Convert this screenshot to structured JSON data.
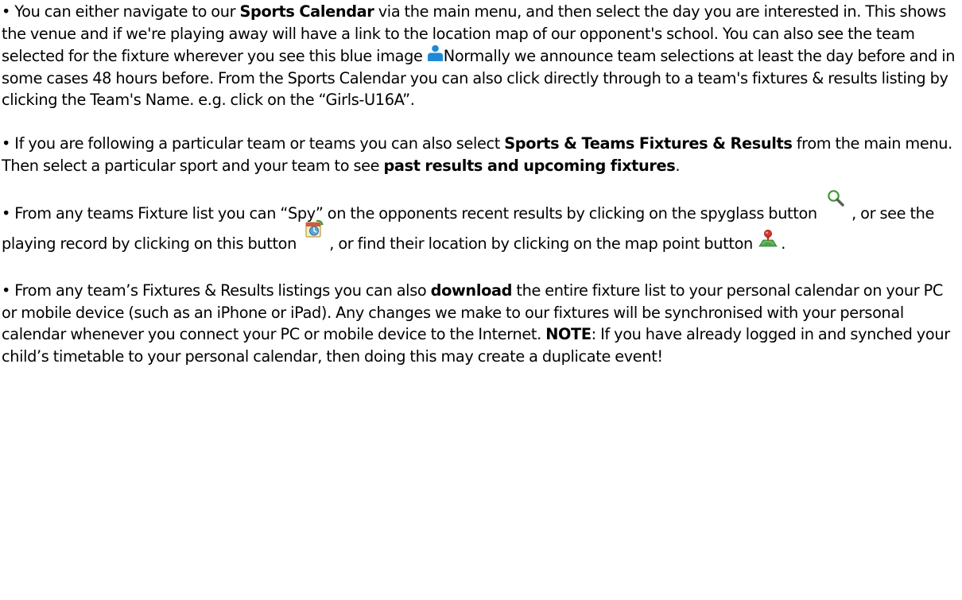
{
  "p1": {
    "t1": "• You can either navigate to our ",
    "b1": "Sports Calendar",
    "t2": " via the main menu, and then select the day you are interested in. This shows the venue and if we're playing away will have a link to the location map of our opponent's school. You can also see the team selected for the fixture wherever you see this blue image ",
    "t3": "Normally we announce team selections at least the day before and in some cases 48 hours before. From the Sports Calendar you can also click directly through to a team's fixtures & results listing by clicking the Team's Name. e.g. click on the “Girls-U16A”."
  },
  "p2": {
    "t1": "• If you are following a particular team or teams you can also select ",
    "b1": "Sports & Teams Fixtures & Results",
    "t2": " from the main menu. Then select a particular sport and your team to see ",
    "b2": "past results and upcoming fixtures",
    "t3": "."
  },
  "p3": {
    "t1": "• From any teams Fixture list you can “Spy” on the opponents recent results by clicking on the spyglass button ",
    "t2": ", or see the playing record by clicking on this button ",
    "t3": ",  or find their location by clicking on the map point button ",
    "t4": "."
  },
  "p4": {
    "t1": "• From any team’s Fixtures & Results listings you can also ",
    "b1": "download",
    "t2": " the entire fixture list to your personal calendar on your PC or mobile device (such as an iPhone or iPad). Any changes we make to our fixtures will be synchronised with your personal calendar whenever you connect your PC or mobile device to the Internet. ",
    "b2": "NOTE",
    "t3": ": If you have already logged in and synched your child’s timetable to your personal calendar, then doing this may create a duplicate event!"
  },
  "icons": {
    "team": "person-icon",
    "spy": "spyglass-icon",
    "record": "playing-record-icon",
    "map": "map-point-icon"
  },
  "colors": {
    "text": "#000000",
    "team_icon": "#1e8ad6",
    "spyglass": "#3f9a33",
    "map_pin": "#d9352a"
  }
}
